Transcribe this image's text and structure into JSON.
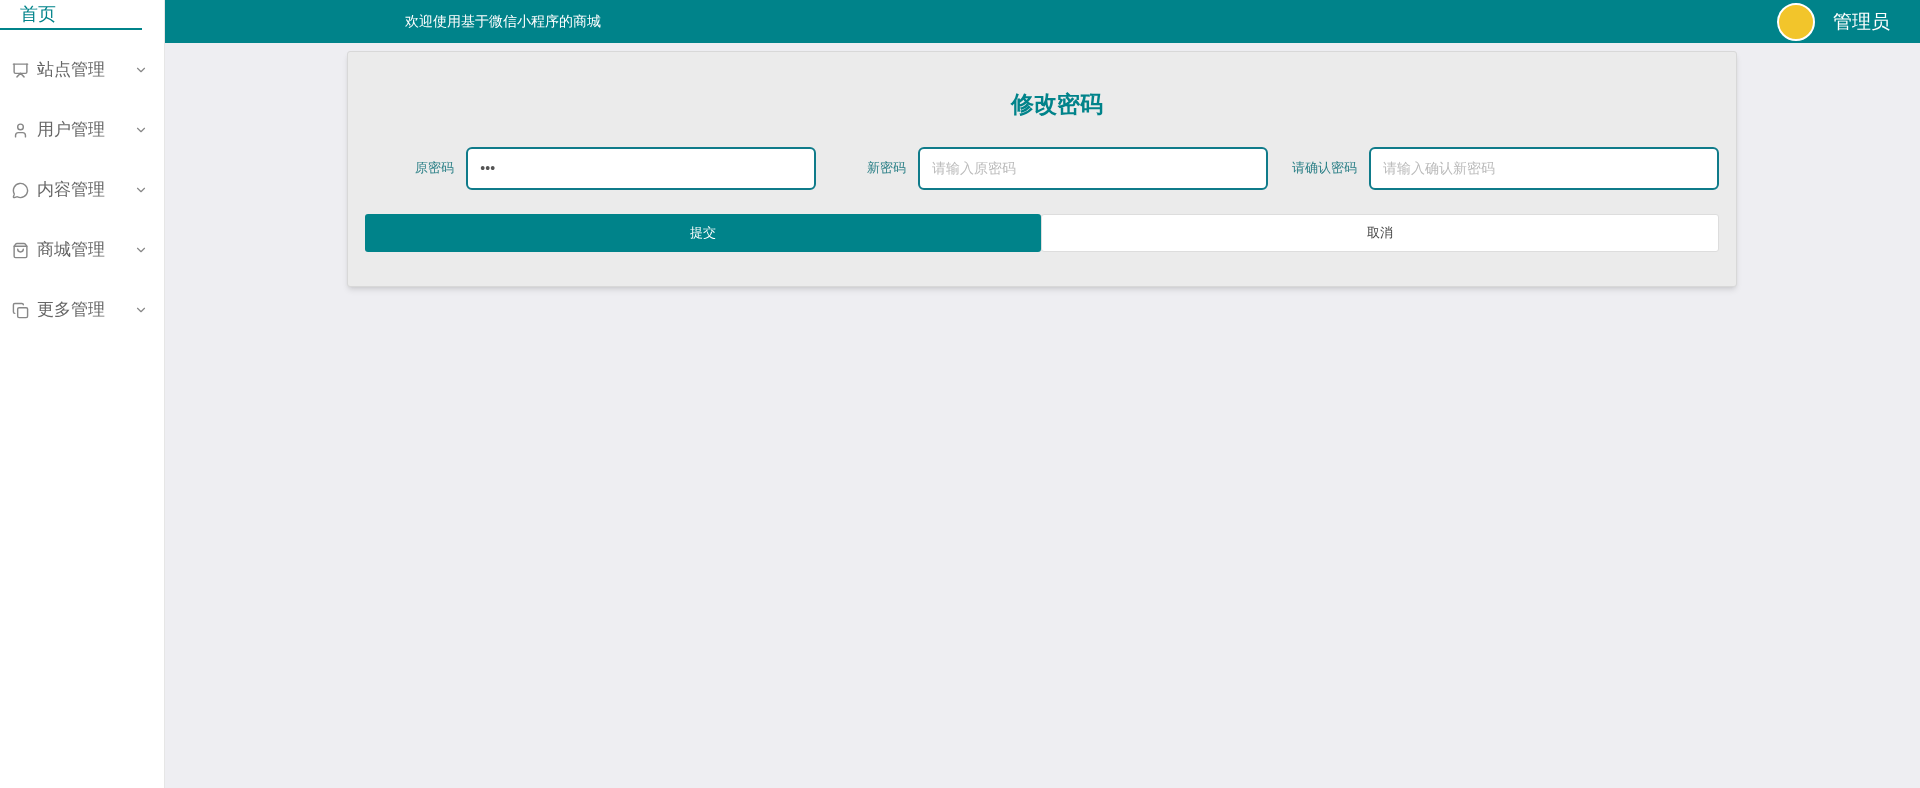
{
  "header": {
    "home": "首页",
    "welcome": "欢迎使用基于微信小程序的商城",
    "user": "管理员"
  },
  "sidebar": {
    "items": [
      {
        "kind": "site",
        "label": "站点管理",
        "expanded": false
      },
      {
        "kind": "user",
        "label": "用户管理",
        "expanded": false
      },
      {
        "kind": "content",
        "label": "内容管理",
        "expanded": false
      },
      {
        "kind": "shop",
        "label": "商城管理",
        "expanded": false
      },
      {
        "kind": "more",
        "label": "更多管理",
        "expanded": false
      }
    ]
  },
  "form": {
    "title": "修改密码",
    "fields": [
      {
        "label": "原密码",
        "value": "•••"
      },
      {
        "label": "新密码",
        "placeholder": "请输入原密码"
      },
      {
        "label": "请确认密码",
        "placeholder": "请输入确认新密码"
      }
    ],
    "buttons": [
      {
        "kind": "primary",
        "label": "提交"
      },
      {
        "kind": "plain",
        "label": "取消"
      }
    ]
  }
}
